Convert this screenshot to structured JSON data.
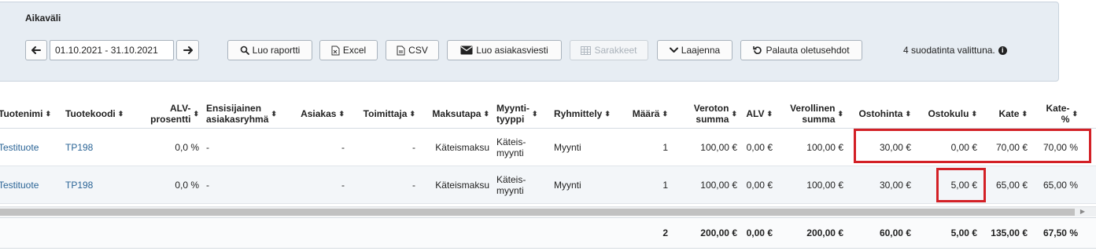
{
  "filter": {
    "title": "Aikaväli",
    "date_range": "01.10.2021 - 31.10.2021",
    "buttons": {
      "create_report": "Luo raportti",
      "excel": "Excel",
      "csv": "CSV",
      "customer_message": "Luo asiakasviesti",
      "columns": "Sarakkeet",
      "expand": "Laajenna",
      "reset": "Palauta oletusehdot"
    },
    "note": "4 suodatinta valittuna.",
    "info_icon": "i"
  },
  "table": {
    "columns": [
      {
        "l1": "Tuotenimi",
        "l2": ""
      },
      {
        "l1": "Tuotekoodi",
        "l2": ""
      },
      {
        "l1": "ALV-",
        "l2": "prosentti"
      },
      {
        "l1": "Ensisijainen",
        "l2": "asiakasryhmä"
      },
      {
        "l1": "Asiakas",
        "l2": ""
      },
      {
        "l1": "Toimittaja",
        "l2": ""
      },
      {
        "l1": "Maksutapa",
        "l2": ""
      },
      {
        "l1": "Myynti-",
        "l2": "tyyppi"
      },
      {
        "l1": "Ryhmittely",
        "l2": ""
      },
      {
        "l1": "Määrä",
        "l2": ""
      },
      {
        "l1": "Veroton",
        "l2": "summa"
      },
      {
        "l1": "ALV",
        "l2": ""
      },
      {
        "l1": "Verollinen",
        "l2": "summa"
      },
      {
        "l1": "Ostohinta",
        "l2": ""
      },
      {
        "l1": "Ostokulu",
        "l2": ""
      },
      {
        "l1": "Kate",
        "l2": ""
      },
      {
        "l1": "Kate-",
        "l2": "%"
      }
    ],
    "rows": [
      {
        "product": "Testituote",
        "code": "TP198",
        "vat_pct": "0,0 %",
        "group": "-",
        "customer": "-",
        "supplier": "-",
        "payment": "Käteismaksu",
        "type_l1": "Käteis-",
        "type_l2": "myynti",
        "grouping": "Myynti",
        "qty": "1",
        "net": "100,00 €",
        "vat": "0,00 €",
        "gross": "100,00 €",
        "purchase_price": "30,00 €",
        "purchase_cost": "0,00 €",
        "margin": "70,00 €",
        "margin_pct": "70,00 %"
      },
      {
        "product": "Testituote",
        "code": "TP198",
        "vat_pct": "0,0 %",
        "group": "-",
        "customer": "-",
        "supplier": "-",
        "payment": "Käteismaksu",
        "type_l1": "Käteis-",
        "type_l2": "myynti",
        "grouping": "Myynti",
        "qty": "1",
        "net": "100,00 €",
        "vat": "0,00 €",
        "gross": "100,00 €",
        "purchase_price": "30,00 €",
        "purchase_cost": "5,00 €",
        "margin": "65,00 €",
        "margin_pct": "65,00 %"
      }
    ],
    "totals": {
      "qty": "2",
      "net": "200,00 €",
      "vat": "0,00 €",
      "gross": "200,00 €",
      "purchase_price": "60,00 €",
      "purchase_cost": "5,00 €",
      "margin": "135,00 €",
      "margin_pct": "67,50 %"
    }
  },
  "colors": {
    "highlight": "#d32026",
    "link": "#2a6496",
    "panel_bg": "#e7edf3"
  },
  "icons": {
    "prev": "arrow-left-icon",
    "next": "arrow-right-icon",
    "search": "search-icon",
    "excel": "excel-file-icon",
    "csv": "csv-file-icon",
    "envelope": "envelope-icon",
    "table": "table-icon",
    "chevron": "chevron-down-icon",
    "undo": "undo-icon",
    "sort": "sort-icon"
  }
}
